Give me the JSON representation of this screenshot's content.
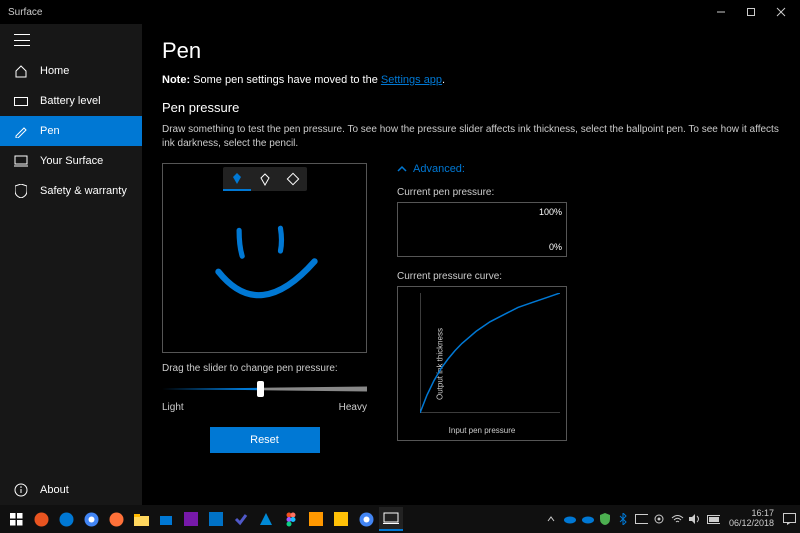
{
  "window": {
    "title": "Surface"
  },
  "sidebar": {
    "items": [
      {
        "icon": "home",
        "label": "Home"
      },
      {
        "icon": "battery",
        "label": "Battery level"
      },
      {
        "icon": "pen",
        "label": "Pen",
        "active": true
      },
      {
        "icon": "device",
        "label": "Your Surface"
      },
      {
        "icon": "shield",
        "label": "Safety & warranty"
      }
    ],
    "about": {
      "icon": "info",
      "label": "About"
    }
  },
  "page": {
    "title": "Pen",
    "note_label": "Note:",
    "note_text": " Some pen settings have moved to the ",
    "note_link": "Settings app",
    "section_title": "Pen pressure",
    "section_desc": "Draw something to test the pen pressure. To see how the pressure slider affects ink thickness, select the ballpoint pen. To see how it affects ink darkness, select the pencil.",
    "tools": [
      "pen-blue",
      "pen-outline",
      "eraser"
    ],
    "slider_label": "Drag the slider to change pen pressure:",
    "slider_light": "Light",
    "slider_heavy": "Heavy",
    "slider_pos_pct": 48,
    "reset": "Reset",
    "advanced": {
      "label": "Advanced:",
      "pressure_label": "Current pen pressure:",
      "pressure_100": "100%",
      "pressure_0": "0%",
      "curve_label": "Current pressure curve:",
      "xlabel": "Input pen pressure",
      "ylabel": "Output ink thickness"
    }
  },
  "chart_data": {
    "type": "line",
    "title": "Current pressure curve",
    "xlabel": "Input pen pressure",
    "ylabel": "Output ink thickness",
    "xlim": [
      0,
      1
    ],
    "ylim": [
      0,
      1
    ],
    "x": [
      0.0,
      0.05,
      0.1,
      0.15,
      0.2,
      0.25,
      0.3,
      0.35,
      0.4,
      0.5,
      0.6,
      0.7,
      0.8,
      0.9,
      1.0
    ],
    "y": [
      0.0,
      0.15,
      0.27,
      0.37,
      0.45,
      0.52,
      0.58,
      0.63,
      0.68,
      0.76,
      0.82,
      0.88,
      0.92,
      0.96,
      1.0
    ]
  },
  "taskbar": {
    "time": "16:17",
    "date": "06/12/2018"
  }
}
